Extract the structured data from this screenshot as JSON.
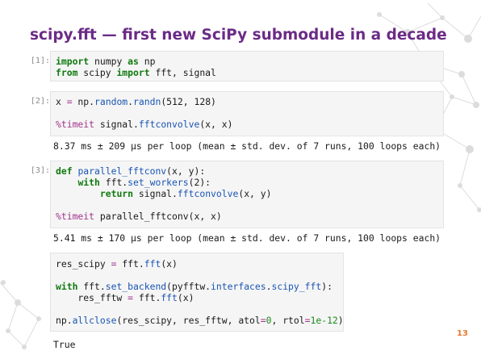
{
  "slide": {
    "title": "scipy.fft — first new SciPy submodule in a decade",
    "page_number": "13"
  },
  "cells": [
    {
      "prompt": "[1]:",
      "lines": [
        [
          {
            "t": "import",
            "c": "kw"
          },
          {
            "t": " numpy "
          },
          {
            "t": "as",
            "c": "kw"
          },
          {
            "t": " np"
          }
        ],
        [
          {
            "t": "from",
            "c": "kw"
          },
          {
            "t": " scipy "
          },
          {
            "t": "import",
            "c": "kw"
          },
          {
            "t": " fft, signal"
          }
        ]
      ]
    },
    {
      "prompt": "[2]:",
      "lines": [
        [
          {
            "t": "x "
          },
          {
            "t": "=",
            "c": "eq"
          },
          {
            "t": " np."
          },
          {
            "t": "random",
            "c": "fn"
          },
          {
            "t": "."
          },
          {
            "t": "randn",
            "c": "fn"
          },
          {
            "t": "(512, 128)"
          }
        ],
        [],
        [
          {
            "t": "%timeit",
            "c": "mg"
          },
          {
            "t": " signal."
          },
          {
            "t": "fftconvolve",
            "c": "fn"
          },
          {
            "t": "(x, x)"
          }
        ]
      ],
      "output": "8.37 ms ± 209 µs per loop (mean ± std. dev. of 7 runs, 100 loops each)"
    },
    {
      "prompt": "[3]:",
      "lines": [
        [
          {
            "t": "def",
            "c": "kw"
          },
          {
            "t": " "
          },
          {
            "t": "parallel_fftconv",
            "c": "fn"
          },
          {
            "t": "(x, y):"
          }
        ],
        [
          {
            "t": "    "
          },
          {
            "t": "with",
            "c": "kw"
          },
          {
            "t": " fft."
          },
          {
            "t": "set_workers",
            "c": "fn"
          },
          {
            "t": "(2):"
          }
        ],
        [
          {
            "t": "        "
          },
          {
            "t": "return",
            "c": "kw"
          },
          {
            "t": " signal."
          },
          {
            "t": "fftconvolve",
            "c": "fn"
          },
          {
            "t": "(x, y)"
          }
        ],
        [],
        [
          {
            "t": "%timeit",
            "c": "mg"
          },
          {
            "t": " parallel_fftconv(x, x)"
          }
        ]
      ],
      "output": "5.41 ms ± 170 µs per loop (mean ± std. dev. of 7 runs, 100 loops each)"
    },
    {
      "prompt": "",
      "lines": [
        [
          {
            "t": "res_scipy "
          },
          {
            "t": "=",
            "c": "eq"
          },
          {
            "t": " fft."
          },
          {
            "t": "fft",
            "c": "fn"
          },
          {
            "t": "(x)"
          }
        ],
        [],
        [
          {
            "t": "with",
            "c": "kw"
          },
          {
            "t": " fft."
          },
          {
            "t": "set_backend",
            "c": "fn"
          },
          {
            "t": "(pyfftw."
          },
          {
            "t": "interfaces",
            "c": "fn"
          },
          {
            "t": "."
          },
          {
            "t": "scipy_fft",
            "c": "fn"
          },
          {
            "t": "):"
          }
        ],
        [
          {
            "t": "    res_fftw "
          },
          {
            "t": "=",
            "c": "eq"
          },
          {
            "t": " fft."
          },
          {
            "t": "fft",
            "c": "fn"
          },
          {
            "t": "(x)"
          }
        ],
        [],
        [
          {
            "t": "np."
          },
          {
            "t": "allclose",
            "c": "fn"
          },
          {
            "t": "(res_scipy, res_fftw, atol"
          },
          {
            "t": "=",
            "c": "eq"
          },
          {
            "t": "0",
            "c": "num"
          },
          {
            "t": ", rtol"
          },
          {
            "t": "=",
            "c": "eq"
          },
          {
            "t": "1e-12",
            "c": "num"
          },
          {
            "t": ")"
          }
        ]
      ],
      "output": "True"
    }
  ]
}
